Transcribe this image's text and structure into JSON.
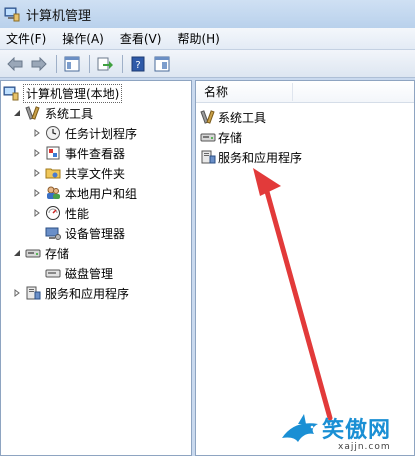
{
  "window": {
    "title": "计算机管理"
  },
  "menu": [
    {
      "label": "文件(F)"
    },
    {
      "label": "操作(A)"
    },
    {
      "label": "查看(V)"
    },
    {
      "label": "帮助(H)"
    }
  ],
  "tree": {
    "root": "计算机管理(本地)",
    "system_tools": "系统工具",
    "items": [
      {
        "label": "任务计划程序",
        "icon": "clock-icon"
      },
      {
        "label": "事件查看器",
        "icon": "event-viewer-icon"
      },
      {
        "label": "共享文件夹",
        "icon": "shared-folder-icon"
      },
      {
        "label": "本地用户和组",
        "icon": "users-icon"
      },
      {
        "label": "性能",
        "icon": "performance-icon"
      },
      {
        "label": "设备管理器",
        "icon": "device-manager-icon"
      }
    ],
    "storage": "存储",
    "disk_management": "磁盘管理",
    "services": "服务和应用程序"
  },
  "list": {
    "column_header": "名称",
    "rows": [
      {
        "label": "系统工具",
        "icon": "tools-icon"
      },
      {
        "label": "存储",
        "icon": "storage-icon"
      },
      {
        "label": "服务和应用程序",
        "icon": "services-icon"
      }
    ]
  },
  "watermark": {
    "text": "笑傲网",
    "sub": "xajjn.com"
  },
  "colors": {
    "arrow": "#e23a3a",
    "watermark": "#1a8fd4"
  }
}
